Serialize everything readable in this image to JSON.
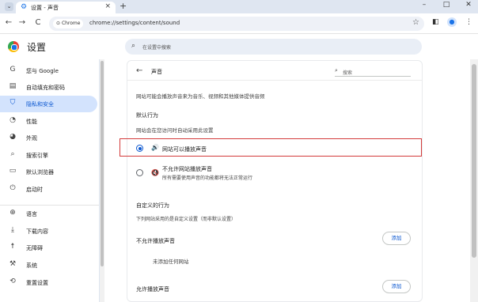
{
  "window": {
    "tab_title": "设置 - 声音",
    "tab_close": "×",
    "new_tab": "+",
    "tab_search": "⌄",
    "minimize": "–",
    "maximize": "□",
    "close": "✕"
  },
  "toolbar": {
    "back": "←",
    "forward": "→",
    "reload": "C",
    "omnibox_chip": "Chrome",
    "url": "chrome://settings/content/sound"
  },
  "header": {
    "title": "设置",
    "search_placeholder": "在设置中搜索"
  },
  "sidebar": {
    "items": [
      {
        "label": "您与 Google",
        "icon": "G",
        "icon_name": "google-icon"
      },
      {
        "label": "自动填充和密码",
        "icon": "▤",
        "icon_name": "autofill-icon"
      },
      {
        "label": "隐私和安全",
        "icon": "⛉",
        "icon_name": "shield-icon",
        "active": true
      },
      {
        "label": "性能",
        "icon": "◔",
        "icon_name": "performance-icon"
      },
      {
        "label": "外观",
        "icon": "◕",
        "icon_name": "palette-icon"
      },
      {
        "label": "搜索引擎",
        "icon": "⌕",
        "icon_name": "search-engine-icon"
      },
      {
        "label": "默认浏览器",
        "icon": "▭",
        "icon_name": "browser-icon"
      },
      {
        "label": "启动时",
        "icon": "⏻",
        "icon_name": "power-icon"
      },
      {
        "label": "语言",
        "icon": "⊕",
        "icon_name": "globe-icon"
      },
      {
        "label": "下载内容",
        "icon": "⤓",
        "icon_name": "download-icon"
      },
      {
        "label": "无障碍",
        "icon": "☨",
        "icon_name": "accessibility-icon"
      },
      {
        "label": "系统",
        "icon": "⚒",
        "icon_name": "wrench-icon"
      },
      {
        "label": "重置设置",
        "icon": "⟲",
        "icon_name": "reset-icon"
      }
    ]
  },
  "content": {
    "back_icon": "←",
    "page_title": "声音",
    "search_placeholder": "搜索",
    "intro": "网站可能会播放声音来为音乐、视频和其他媒体提供音频",
    "default_behavior_heading": "默认行为",
    "default_behavior_sub": "网站会在您访问时自动采用此设置",
    "option_allow": "网站可以播放声音",
    "option_block": "不允许网站播放声音",
    "option_block_sub": "所有需要使用声音的功能都将无法正常运行",
    "custom_heading": "自定义的行为",
    "custom_sub": "下列网站采用的是自定义设置（而非默认设置）",
    "not_allowed_heading": "不允许播放声音",
    "no_sites": "未添加任何网站",
    "allowed_heading": "允许播放声音",
    "add_label": "添加",
    "selected_option": "allow"
  },
  "colors": {
    "accent": "#0b57d0",
    "highlight_border": "#d33b3b",
    "active_sidebar": "#d3e3fd"
  }
}
